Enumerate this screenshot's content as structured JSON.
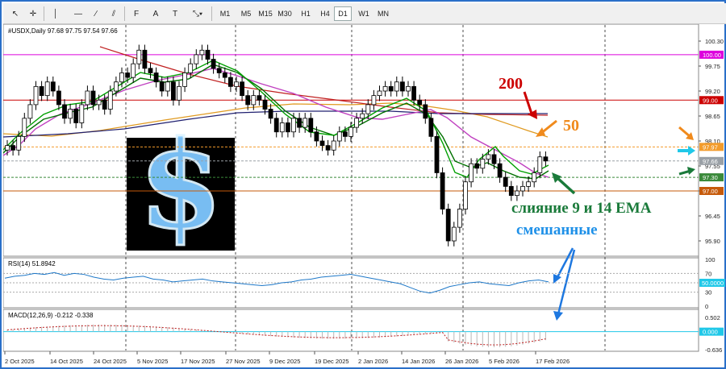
{
  "toolbar": {
    "tools": [
      {
        "name": "cursor-icon",
        "glyph": "↖"
      },
      {
        "name": "crosshair-icon",
        "glyph": "✛"
      },
      {
        "name": "vertical-line-icon",
        "glyph": "│"
      },
      {
        "name": "horizontal-line-icon",
        "glyph": "—"
      },
      {
        "name": "trendline-icon",
        "glyph": "∕"
      },
      {
        "name": "channel-icon",
        "glyph": "⫽"
      },
      {
        "name": "fibonacci-icon",
        "glyph": "F"
      },
      {
        "name": "text-icon",
        "glyph": "A"
      },
      {
        "name": "text-label-icon",
        "glyph": "T"
      },
      {
        "name": "shapes-icon",
        "glyph": "⤡▾"
      }
    ],
    "timeframes": [
      "M1",
      "M5",
      "M15",
      "M30",
      "H1",
      "H4",
      "D1",
      "W1",
      "MN"
    ],
    "active_timeframe": "D1"
  },
  "chart_header": "#USDX,Daily  97.68 97.75 97.54 97.66",
  "price_axis": {
    "ticks": [
      "100.30",
      "99.75",
      "99.20",
      "98.65",
      "98.10",
      "97.55",
      "97.00",
      "96.45",
      "95.90"
    ],
    "badges": [
      {
        "label": "100.00",
        "color": "#dd00dd",
        "price": 100.0
      },
      {
        "label": "99.00",
        "color": "#cc0000",
        "price": 99.0
      },
      {
        "label": "97.97",
        "color": "#f39c2c",
        "price": 97.97
      },
      {
        "label": "97.66",
        "color": "#9aa0a6",
        "price": 97.66
      },
      {
        "label": "97.30",
        "color": "#3a8a3a",
        "price": 97.3
      },
      {
        "label": "97.00",
        "color": "#c65a0a",
        "price": 97.0
      }
    ]
  },
  "date_axis": [
    "2 Oct 2025",
    "14 Oct 2025",
    "24 Oct 2025",
    "5 Nov 2025",
    "17 Nov 2025",
    "27 Nov 2025",
    "9 Dec 2025",
    "19 Dec 2025",
    "2 Jan 2026",
    "14 Jan 2026",
    "26 Jan 2026",
    "5 Feb 2026",
    "17 Feb 2026"
  ],
  "annotations": {
    "ma200": "200",
    "ma50": "50",
    "ema_merge": "слияние 9 и 14 ЕМА",
    "mixed": "смешанные"
  },
  "rsi": {
    "label": "RSI(14) 51.8942",
    "ticks": [
      "100",
      "70",
      "50.0000",
      "30",
      "0"
    ],
    "value": 51.8942
  },
  "macd": {
    "label": "MACD(12,26,9) -0.212 -0.338",
    "ticks": [
      "0.502",
      "0.000",
      "-0.636"
    ]
  },
  "colors": {
    "ema9": "#00a000",
    "ema14": "#007000",
    "ma_purple": "#c040c0",
    "ma50": "#e09a20",
    "ma200": "#c02020",
    "ma_navy": "#202070",
    "rsi_line": "#1e78c8",
    "arrow_red": "#cc0000",
    "arrow_orange": "#f08a1c",
    "arrow_cyan": "#20c8e8",
    "arrow_green": "#1a7a3a",
    "arrow_blue": "#1e78e0"
  }
}
